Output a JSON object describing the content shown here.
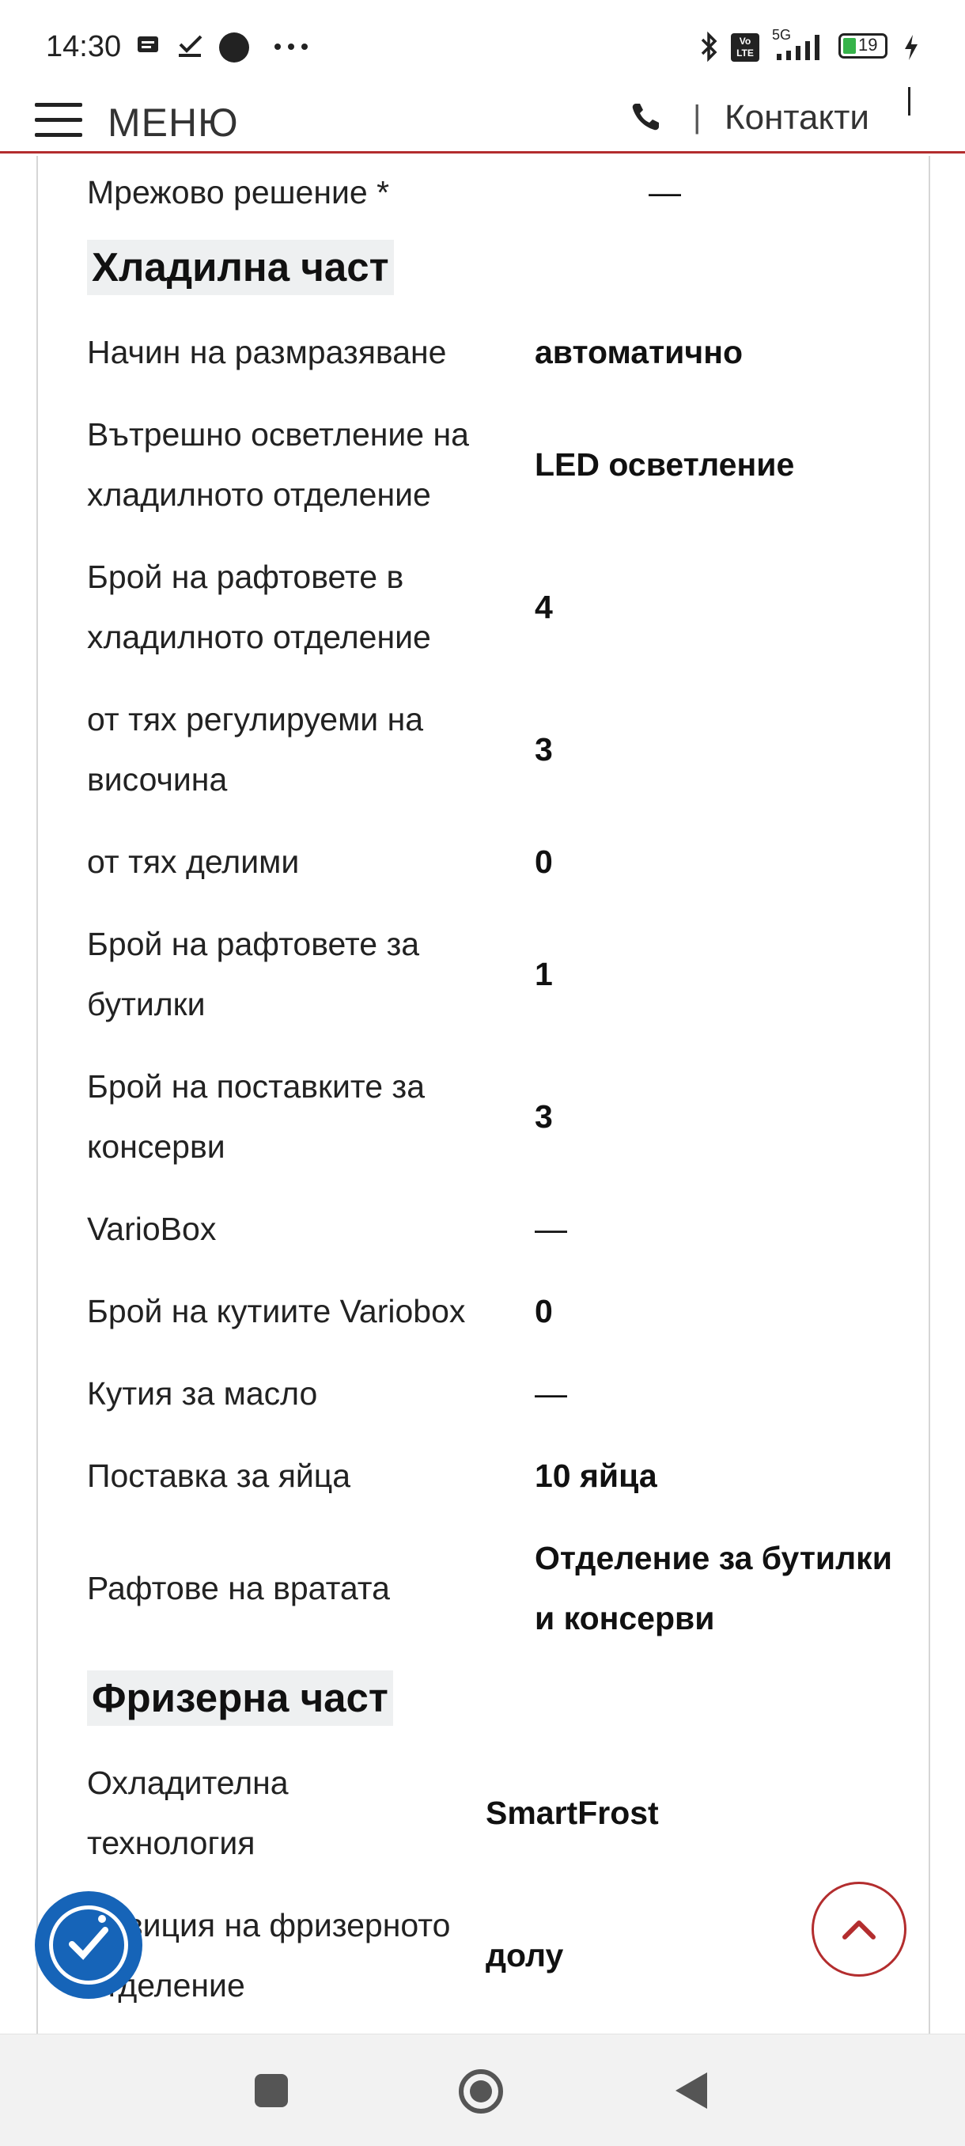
{
  "status_bar": {
    "time": "14:30",
    "icons": [
      "message-icon",
      "check-icon",
      "record-icon",
      "more-icon",
      "bluetooth-icon",
      "volte-icon",
      "signal-5g-icon",
      "battery-icon",
      "charging-icon"
    ],
    "battery_level": "19",
    "network": "5G",
    "volte_label": "Vo LTE"
  },
  "header": {
    "menu_label": "МЕНЮ",
    "contacts_label": "Контакти",
    "separator": "|",
    "accent_color": "#b32d2e"
  },
  "specs": {
    "top_row": {
      "label": "Мрежово решение *",
      "value": "—"
    },
    "fridge": {
      "title": "Хладилна част",
      "rows": [
        {
          "label": "Начин на размразяване",
          "value": "автоматично"
        },
        {
          "label": "Вътрешно осветление на хладилното отделение",
          "value": "LED осветление"
        },
        {
          "label": "Брой на рафтовете в хладилното отделение",
          "value": "4"
        },
        {
          "label": "от тях регулируеми на височина",
          "value": "3"
        },
        {
          "label": "от тях делими",
          "value": "0"
        },
        {
          "label": "Брой на рафтовете за бутилки",
          "value": "1"
        },
        {
          "label": "Брой на поставките за консерви",
          "value": "3"
        },
        {
          "label": "VarioBox",
          "value": "—"
        },
        {
          "label": "Брой на кутиите Variobox",
          "value": "0"
        },
        {
          "label": "Кутия за масло",
          "value": "—"
        },
        {
          "label": "Поставка за яйца",
          "value": "10 яйца"
        },
        {
          "label": "Рафтове на вратата",
          "value": "Отделение за бутилки и консерви"
        }
      ]
    },
    "freezer": {
      "title": "Фризерна част",
      "rows": [
        {
          "label": "Охладителна технология",
          "value": "SmartFrost"
        },
        {
          "label": "Позиция на фризерното отделение",
          "value": "долу"
        }
      ]
    }
  },
  "floating": {
    "accessibility_icon": "accessibility-icon",
    "scroll_top_icon": "chevron-up-icon",
    "accessibility_color": "#1664b8"
  },
  "nav_bar": {
    "icons": [
      "recents-square-icon",
      "home-circle-icon",
      "back-triangle-icon"
    ]
  }
}
